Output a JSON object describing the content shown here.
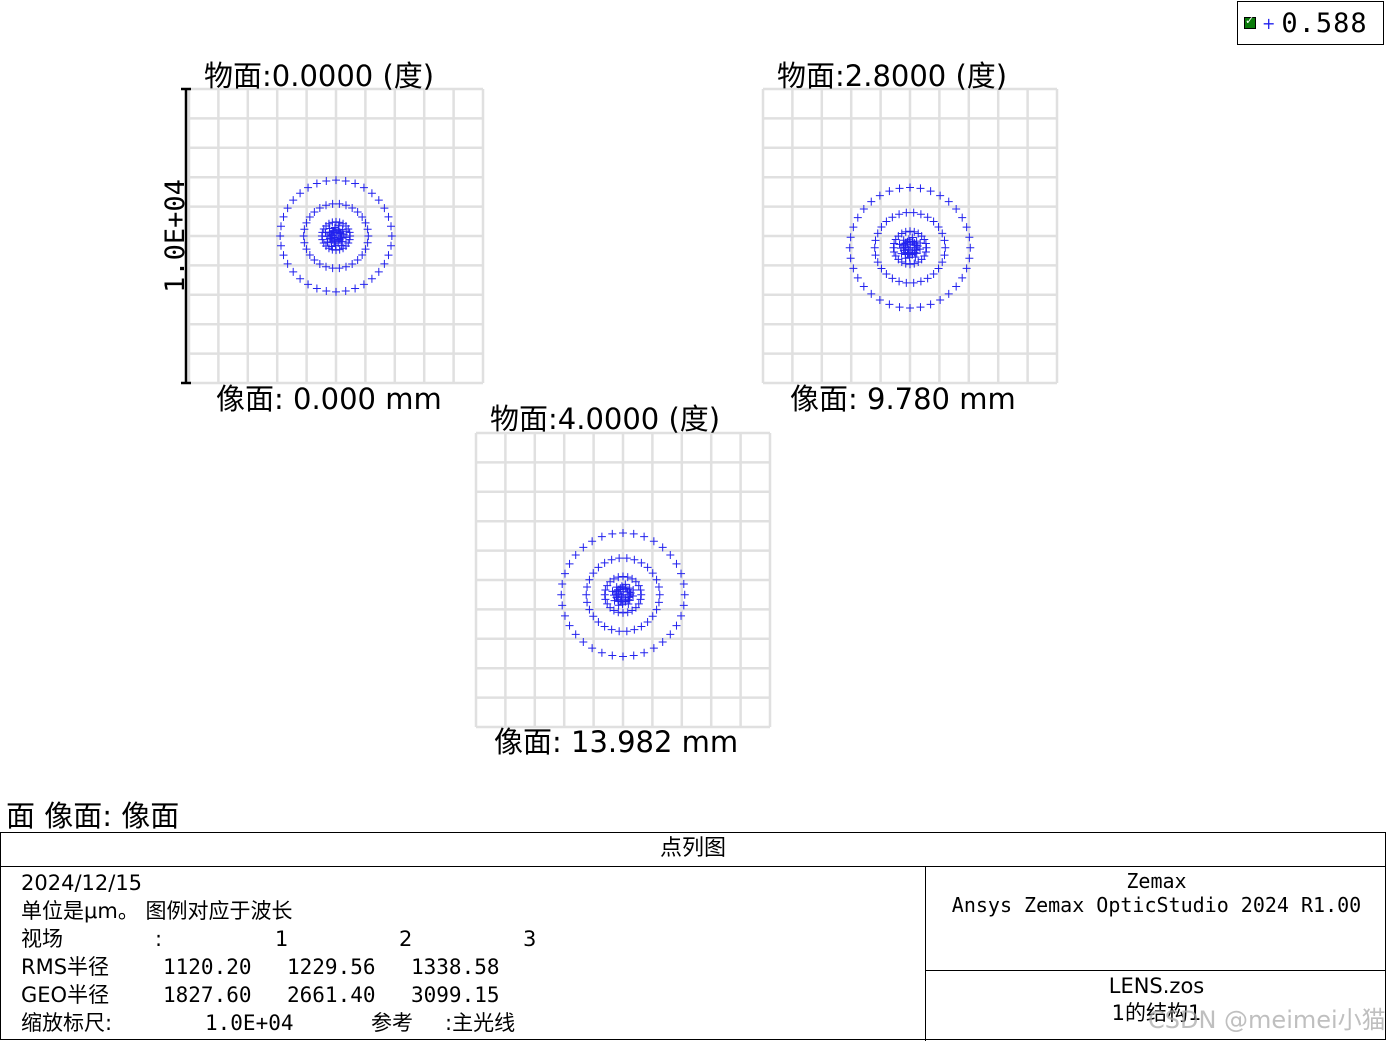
{
  "legend": {
    "value": "0.588",
    "marker_color": "#2222ee"
  },
  "chart_data": {
    "type": "scatter",
    "title": "点列图",
    "scale_bar_label": "1.0E+04",
    "marker": "+",
    "marker_color": "#2222ee",
    "grid": true,
    "panels": [
      {
        "field_label": "物面:0.0000 (度)",
        "image_label": "像面: 0.000 mm",
        "rings": [
          {
            "radius": 1900,
            "count": 36
          },
          {
            "radius": 1100,
            "count": 30
          },
          {
            "radius": 480,
            "count": 24
          },
          {
            "radius": 180,
            "count": 16
          }
        ],
        "center": [
          0,
          0
        ]
      },
      {
        "field_label": "物面:2.8000 (度)",
        "image_label": "像面: 9.780 mm",
        "rings": [
          {
            "radius": 2050,
            "count": 36
          },
          {
            "radius": 1200,
            "count": 30
          },
          {
            "radius": 560,
            "count": 24
          },
          {
            "radius": 220,
            "count": 16
          }
        ],
        "center": [
          0,
          400
        ]
      },
      {
        "field_label": "物面:4.0000 (度)",
        "image_label": "像面: 13.982 mm",
        "rings": [
          {
            "radius": 2100,
            "count": 36
          },
          {
            "radius": 1250,
            "count": 30
          },
          {
            "radius": 620,
            "count": 24
          },
          {
            "radius": 240,
            "count": 16
          }
        ],
        "center": [
          0,
          500
        ]
      }
    ]
  },
  "surface_line": "面 像面: 像面",
  "info": {
    "title": "点列图",
    "date": "2024/12/15",
    "units_line": "单位是μm。 图例对应于波长",
    "field_label": "视场",
    "field_sep": ":",
    "fields": [
      "1",
      "2",
      "3"
    ],
    "rms_label": "RMS半径",
    "rms_values": [
      "1120.20",
      "1229.56",
      "1338.58"
    ],
    "geo_label": "GEO半径",
    "geo_values": [
      "1827.60",
      "2661.40",
      "3099.15"
    ],
    "scale_label": "缩放标尺:",
    "scale_value": "1.0E+04",
    "ref_label": "参考",
    "ref_value": ":主光线",
    "vendor": "Zemax",
    "product": "Ansys Zemax OpticStudio 2024 R1.00",
    "file": "LENS.zos",
    "config": "1的结构1"
  },
  "watermark": "CSDN @meimei小猫"
}
